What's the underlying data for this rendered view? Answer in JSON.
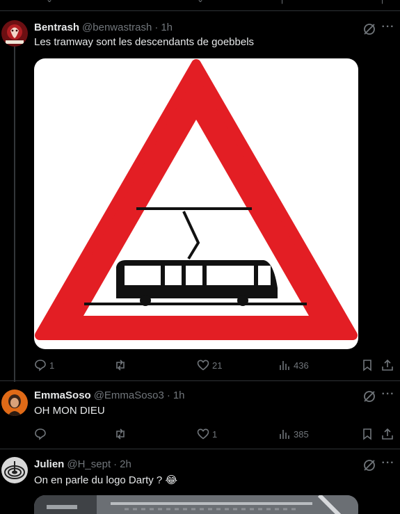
{
  "tweets": [
    {
      "name": "Bentrash",
      "handle": "@benwastrash",
      "time": "1h",
      "text": "Les tramway sont les descendants de goebbels",
      "replies": "1",
      "reposts": "",
      "likes": "21",
      "views": "436"
    },
    {
      "name": "EmmaSoso",
      "handle": "@EmmaSoso3",
      "time": "1h",
      "text": "OH MON DIEU",
      "replies": "",
      "reposts": "",
      "likes": "1",
      "views": "385"
    },
    {
      "name": "Julien",
      "handle": "@H_sept",
      "time": "2h",
      "text": "On en parle du logo Darty ? 😂"
    }
  ],
  "separator": "·",
  "more_label": "···",
  "icons": {
    "reply": "reply-icon",
    "repost": "repost-icon",
    "like": "like-icon",
    "views": "views-icon",
    "bookmark": "bookmark-icon",
    "share": "share-icon",
    "grok": "grok-icon",
    "more": "more-icon"
  },
  "colors": {
    "background": "#000000",
    "text": "#e7e9ea",
    "muted": "#71767b",
    "divider": "#2f3336",
    "sign_red": "#e31e24"
  }
}
